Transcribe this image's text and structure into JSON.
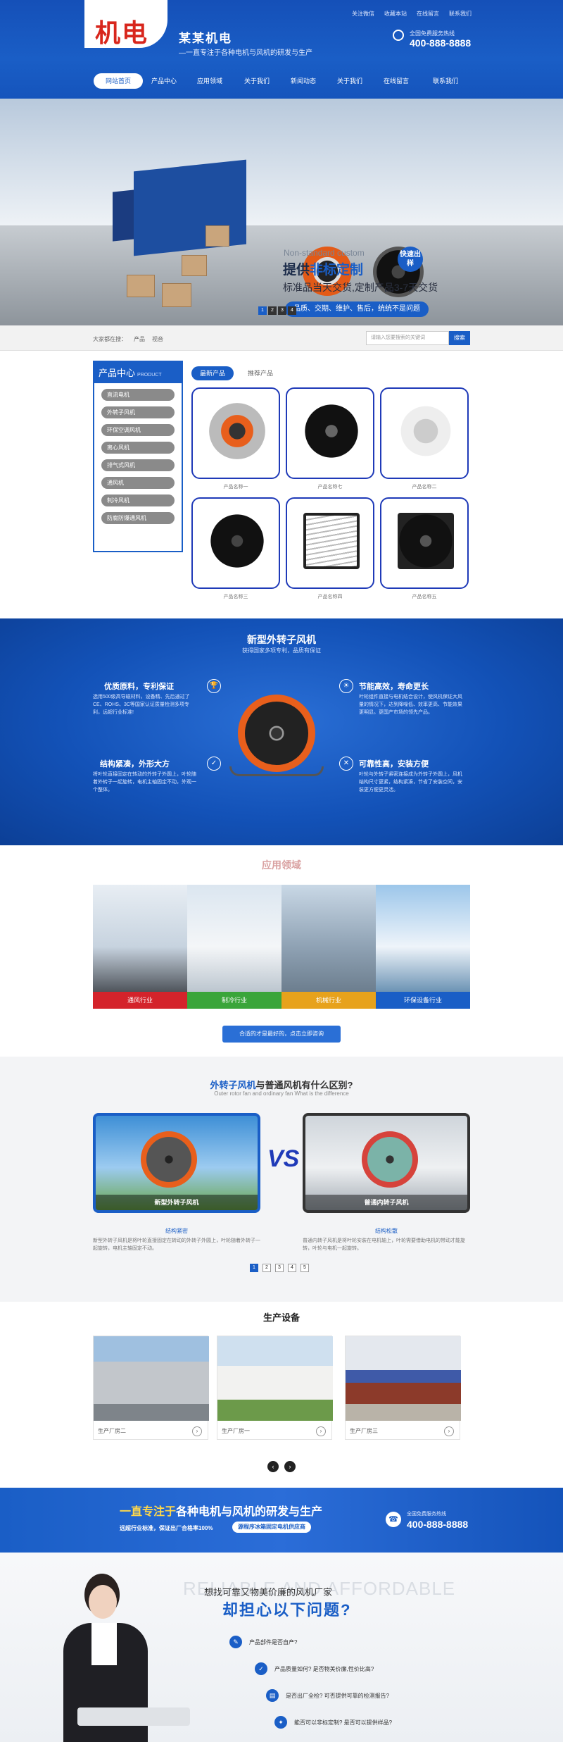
{
  "header": {
    "logo": "机电",
    "site_name": "某某机电",
    "slogan": "—一直专注于各种电机与风机的研发与生产",
    "toplinks": [
      "关注微信",
      "收藏本站",
      "在线留言",
      "联系我们"
    ],
    "phone_label": "全国免费服务热线",
    "phone": "400-888-8888"
  },
  "nav": [
    "网站首页",
    "产品中心",
    "应用领域",
    "关于我们",
    "新闻动态",
    "关于我们",
    "在线留言",
    "联系我们"
  ],
  "banner": {
    "en": "Non-standard custom",
    "title_a": "提供",
    "title_b": "非标定制",
    "badge": "快速出样",
    "subtitle": "标准品当天交货,定制产品3-7天交货",
    "pill": "品质、交期、维护、售后，统统不是问题",
    "slides": [
      "1",
      "2",
      "3",
      "4"
    ]
  },
  "search": {
    "hot_label": "大家都在搜：",
    "hot": [
      "产品",
      "视音"
    ],
    "placeholder": "请输入您要搜索的关键词",
    "button": "搜索"
  },
  "products": {
    "panel_title": "产品中心",
    "panel_en": "PRODUCT",
    "categories": [
      "直流电机",
      "外转子风机",
      "环保空调风机",
      "离心风机",
      "排气式风机",
      "通风机",
      "制冷风机",
      "防腐防爆通风机"
    ],
    "tabs": [
      "最新产品",
      "推荐产品"
    ],
    "items": [
      "产品名称一",
      "产品名称七",
      "产品名称二",
      "产品名称三",
      "产品名称四",
      "产品名称五"
    ]
  },
  "feature": {
    "title": "新型外转子风机",
    "subtitle": "获得国家多项专利，品质有保证",
    "points": [
      {
        "title": "优质原料，专利保证",
        "text": "选用500级高导磁材料，设备精、先后通过了CE、ROHS、3C等国家认证质量检测多项专利，远超行业标准!",
        "icon": "🏆"
      },
      {
        "title": "节能高效，寿命更长",
        "text": "叶轮组件直接与电机结合设计，使风机保证大风量的情况下，达到降噪低、效率更高、节能效果更明显。更国产市场的领先产品。",
        "icon": "☀"
      },
      {
        "title": "结构紧凑，外形大方",
        "text": "将叶轮直接固定在转动的外转子外圆上，叶轮随着外转子一起旋转，电机主轴固定不动，外观一个整体。",
        "icon": "✓"
      },
      {
        "title": "可靠性高，安装方便",
        "text": "叶轮与外转子紧密连接成为外转子外圆上，风机结构尺寸更紧，结构紧凑，节省了安装空间，安装更方便更灵活。",
        "icon": "✕"
      }
    ]
  },
  "application": {
    "title": "应用领域",
    "items": [
      {
        "label": "通风行业",
        "color": "#d4232b"
      },
      {
        "label": "制冷行业",
        "color": "#3aa53a"
      },
      {
        "label": "机械行业",
        "color": "#e7a21c"
      },
      {
        "label": "环保设备行业",
        "color": "#1a5ec6"
      }
    ],
    "button": "合适的才是最好的，点击立即咨询"
  },
  "compare": {
    "title_a": "外转子风机",
    "title_b": "与普通风机有什么区别?",
    "subtitle": "Outer rotor fan and ordinary fan What is the difference",
    "vs": "VS",
    "left": {
      "caption": "新型外转子风机",
      "head": "结构紧密",
      "text": "新型外转子风机是将叶轮直接固定在转动的外转子外圆上，叶轮随着外转子一起旋转，电机主轴固定不动。"
    },
    "right": {
      "caption": "普通内转子风机",
      "head": "结构松散",
      "text": "普通内转子风机是将叶轮安装在电机轴上，叶轮需要借助电机的带动才能旋转，叶轮与电机一起旋转。"
    },
    "pages": [
      "1",
      "2",
      "3",
      "4",
      "5"
    ]
  },
  "equipment": {
    "title": "生产设备",
    "items": [
      "生产厂房二",
      "生产厂房一",
      "生产厂房三"
    ],
    "arrow": "›",
    "prev": "‹",
    "next": "›"
  },
  "strip": {
    "head_a": "一直专注于",
    "head_b": "各种电机与风机的研发与生产",
    "text": "远超行业标准，保证出厂合格率100%",
    "pill": "源程序冰箱固定电机供应商",
    "phone_label": "全国免费服务热线",
    "phone": "400-888-8888"
  },
  "worry": {
    "watermark": "RELIABLE AND AFFORDABLE",
    "sub": "想找可靠又物美价廉的风机厂家",
    "title": "却担心以下问题?",
    "items": [
      "产品部件是否自产?",
      "产品质量如何? 是否物美价廉,性价比高?",
      "是否出厂全检? 可否提供可靠的检测报告?",
      "能否可以非标定制? 是否可以提供样品?"
    ]
  },
  "colors": {
    "brand": "#1a5ec6",
    "accent_red": "#d8261c",
    "fan_orange": "#e85f1c"
  }
}
